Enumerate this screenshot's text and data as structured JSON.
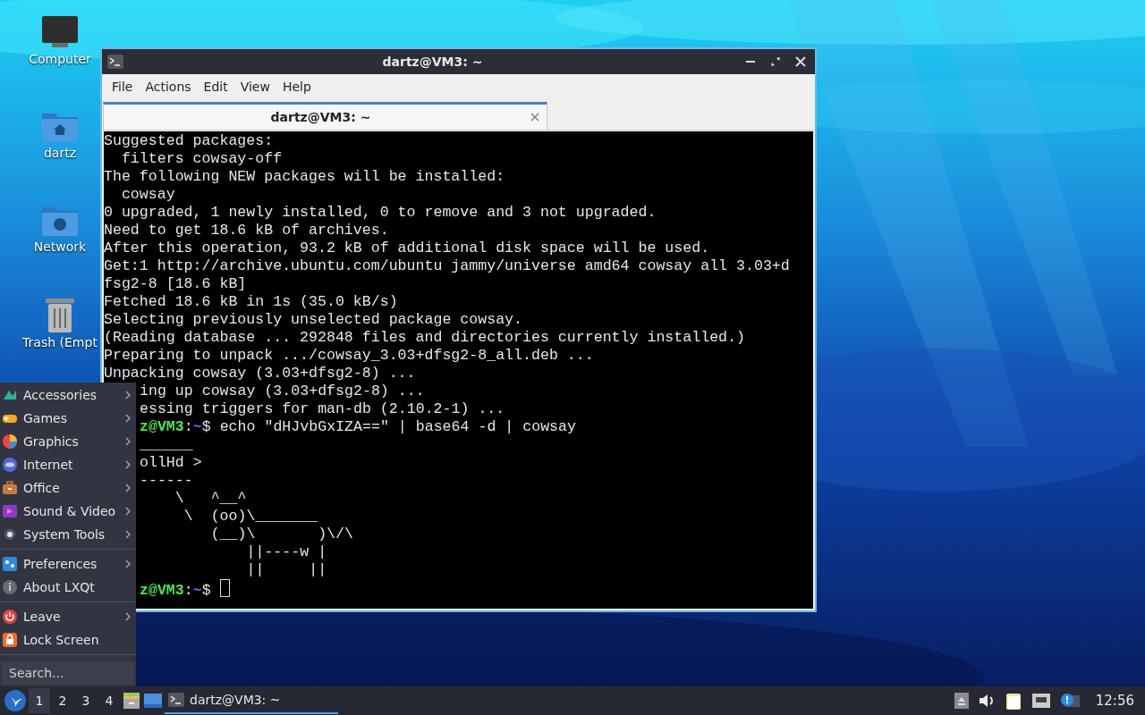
{
  "desktop": {
    "icons": [
      {
        "label": "Computer",
        "kind": "computer"
      },
      {
        "label": "dartz",
        "kind": "home"
      },
      {
        "label": "Network",
        "kind": "network"
      },
      {
        "label": "Trash (Empt",
        "kind": "trash"
      }
    ]
  },
  "window": {
    "title": "dartz@VM3: ~",
    "menu": [
      "File",
      "Actions",
      "Edit",
      "View",
      "Help"
    ],
    "tabs": [
      {
        "label": "dartz@VM3: ~",
        "selected": true
      }
    ],
    "terminal": {
      "lines": [
        "Suggested packages:",
        "  filters cowsay-off",
        "The following NEW packages will be installed:",
        "  cowsay",
        "0 upgraded, 1 newly installed, 0 to remove and 3 not upgraded.",
        "Need to get 18.6 kB of archives.",
        "After this operation, 93.2 kB of additional disk space will be used.",
        "Get:1 http://archive.ubuntu.com/ubuntu jammy/universe amd64 cowsay all 3.03+d",
        "fsg2-8 [18.6 kB]",
        "Fetched 18.6 kB in 1s (35.0 kB/s)",
        "Selecting previously unselected package cowsay.",
        "(Reading database ... 292848 files and directories currently installed.)",
        "Preparing to unpack .../cowsay_3.03+dfsg2-8_all.deb ...",
        "Unpacking cowsay (3.03+dfsg2-8) ..."
      ],
      "lines_beside_menu": [
        {
          "kind": "output",
          "text": "ing up cowsay (3.03+dfsg2-8) ..."
        },
        {
          "kind": "output",
          "text": "essing triggers for man-db (2.10.2-1) ..."
        },
        {
          "kind": "prompt",
          "user": "z@VM3",
          "sep": ":",
          "path": "~",
          "symbol": "$",
          "command": "echo \"dHJvbGxIZA==\" | base64 -d | cowsay",
          "cursor": false
        },
        {
          "kind": "output",
          "text": "______"
        },
        {
          "kind": "output",
          "text": "ollHd >"
        },
        {
          "kind": "output",
          "text": "------"
        },
        {
          "kind": "output",
          "text": "    \\   ^__^"
        },
        {
          "kind": "output",
          "text": "     \\  (oo)\\_______"
        },
        {
          "kind": "output",
          "text": "        (__)\\       )\\/\\"
        },
        {
          "kind": "output",
          "text": "            ||----w |"
        },
        {
          "kind": "output",
          "text": "            ||     ||"
        },
        {
          "kind": "prompt",
          "user": "z@VM3",
          "sep": ":",
          "path": "~",
          "symbol": "$",
          "cursor": true
        }
      ]
    }
  },
  "app_menu": {
    "sections": [
      [
        {
          "label": "Accessories",
          "submenu": true
        },
        {
          "label": "Games",
          "submenu": true
        },
        {
          "label": "Graphics",
          "submenu": true
        },
        {
          "label": "Internet",
          "submenu": true
        },
        {
          "label": "Office",
          "submenu": true
        },
        {
          "label": "Sound & Video",
          "submenu": true
        },
        {
          "label": "System Tools",
          "submenu": true
        }
      ],
      [
        {
          "label": "Preferences",
          "submenu": true
        },
        {
          "label": "About LXQt",
          "submenu": false
        }
      ],
      [
        {
          "label": "Leave",
          "submenu": true
        },
        {
          "label": "Lock Screen",
          "submenu": false
        }
      ]
    ],
    "search": {
      "placeholder": "Search..."
    }
  },
  "taskbar": {
    "desktops": [
      {
        "label": "1",
        "selected": true
      },
      {
        "label": "2",
        "selected": false
      },
      {
        "label": "3",
        "selected": false
      },
      {
        "label": "4",
        "selected": false
      }
    ],
    "tasks": [
      {
        "label": "dartz@VM3: ~",
        "selected": true
      }
    ],
    "clock": "12:56"
  }
}
